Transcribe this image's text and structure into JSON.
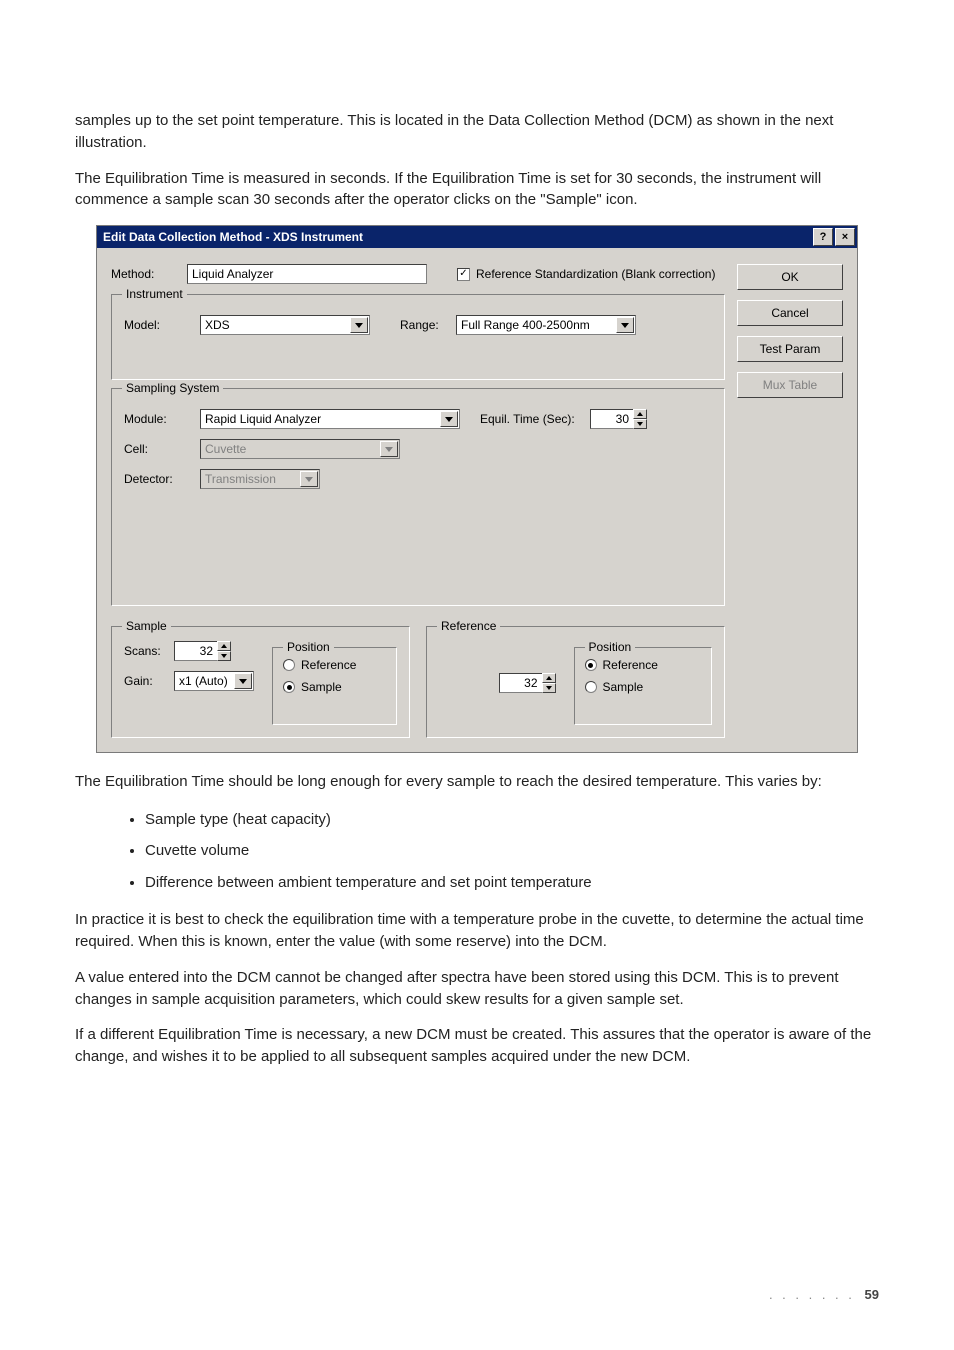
{
  "paragraphs": {
    "p1": "samples up to the set point temperature. This is located in the Data Collection Method (DCM) as shown in the next illustration.",
    "p2": "The Equilibration Time is measured in seconds. If the Equilibration Time is set for 30 seconds, the instrument will commence a sample scan 30 seconds after the operator clicks on the \"Sample\" icon.",
    "p3": "The Equilibration Time should be long enough for every sample to reach the desired temperature. This varies by:",
    "p4": "In practice it is best to check the equilibration time with a temperature probe in the cuvette, to determine the actual time required. When this is known, enter the value (with some reserve) into the DCM.",
    "p5": "A value entered into the DCM cannot be changed after spectra have been stored using this DCM. This is to prevent changes in sample acquisition parameters, which could skew results for a given sample set.",
    "p6": "If a different Equilibration Time is necessary, a new DCM must be created. This assures that the operator is aware of the change, and wishes it to be applied to all subsequent samples acquired under the new DCM."
  },
  "bullets": [
    "Sample type (heat capacity)",
    "Cuvette volume",
    "Difference between ambient temperature and set point temperature"
  ],
  "dialog": {
    "title": "Edit Data Collection Method - XDS Instrument",
    "help_glyph": "?",
    "close_glyph": "×",
    "method_label": "Method:",
    "method_value": "Liquid Analyzer",
    "ref_std_label": "Reference Standardization (Blank correction)",
    "ref_std_checked": true,
    "buttons": {
      "ok": "OK",
      "cancel": "Cancel",
      "test_param": "Test Param",
      "mux_table": "Mux Table"
    },
    "instrument": {
      "legend": "Instrument",
      "model_label": "Model:",
      "model_value": "XDS",
      "range_label": "Range:",
      "range_value": "Full Range 400-2500nm"
    },
    "sampling": {
      "legend": "Sampling System",
      "module_label": "Module:",
      "module_value": "Rapid Liquid Analyzer",
      "equil_label": "Equil. Time (Sec):",
      "equil_value": "30",
      "cell_label": "Cell:",
      "cell_value": "Cuvette",
      "detector_label": "Detector:",
      "detector_value": "Transmission"
    },
    "sample": {
      "legend": "Sample",
      "scans_label": "Scans:",
      "scans_value": "32",
      "gain_label": "Gain:",
      "gain_value": "x1 (Auto)",
      "position_legend": "Position",
      "pos_reference": "Reference",
      "pos_sample": "Sample",
      "pos_selected": "sample"
    },
    "reference": {
      "legend": "Reference",
      "scans_value": "32",
      "position_legend": "Position",
      "pos_reference": "Reference",
      "pos_sample": "Sample",
      "pos_selected": "reference"
    }
  },
  "footer": {
    "dots": ". . . . . . .",
    "page": "59"
  }
}
